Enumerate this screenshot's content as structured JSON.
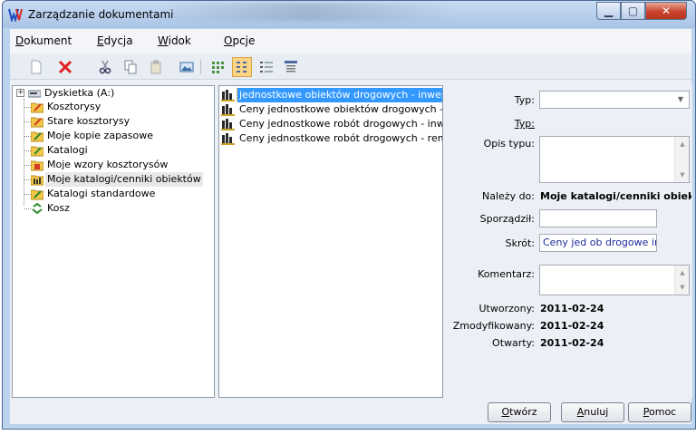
{
  "window": {
    "title": "Zarządzanie dokumentami",
    "minimize_glyph": "▁",
    "maximize_glyph": "▢",
    "close_glyph": "✕"
  },
  "menu": [
    {
      "label_first": "D",
      "label_rest": "okument"
    },
    {
      "label_first": "E",
      "label_rest": "dycja"
    },
    {
      "label_first": "W",
      "label_rest": "idok"
    },
    {
      "label_first": "O",
      "label_rest": "pcje"
    }
  ],
  "toolbar": {
    "icons": [
      "new-document-icon",
      "delete-icon",
      "cut-icon",
      "copy-icon",
      "paste-icon",
      "picture-icon",
      "large-icons-view-icon",
      "small-icons-view-icon",
      "list-view-icon",
      "details-view-icon"
    ],
    "active": "small-icons-view-icon"
  },
  "tree": {
    "items": [
      {
        "label": "Dyskietka (A:)",
        "icon": "floppy-drive-icon"
      },
      {
        "label": "Kosztorysy",
        "icon": "folder-pencil-icon"
      },
      {
        "label": "Stare kosztorysy",
        "icon": "folder-pencil-icon"
      },
      {
        "label": "Moje kopie zapasowe",
        "icon": "folder-pencil-icon"
      },
      {
        "label": "Katalogi",
        "icon": "folder-pencil-icon"
      },
      {
        "label": "Moje wzory kosztorysów",
        "icon": "template-folder-icon"
      },
      {
        "label": "Moje katalogi/cenniki obiektów",
        "icon": "objects-folder-icon"
      },
      {
        "label": "Katalogi standardowe",
        "icon": "folder-pencil-icon"
      },
      {
        "label": "Kosz",
        "icon": "recycle-bin-icon"
      }
    ],
    "selected_index": 6,
    "expander": "+"
  },
  "files": {
    "items": [
      "jednostkowe obiektów drogowych - inwestycyjne",
      "Ceny jednostkowe obiektów drogowych - remontowe",
      "Ceny jednostkowe robót drogowych - inwestycyjne",
      "Ceny jednostkowe robót drogowych - remontowe"
    ],
    "selected_index": 0
  },
  "props": {
    "typ_label": "Typ:",
    "typ_value": "",
    "typ2_label": "Typ:",
    "opis_label": "Opis typu:",
    "opis_value": "",
    "nalezy_label": "Należy do:",
    "nalezy_value": "Moje katalogi/cenniki obiektów",
    "sporzadzil_label": "Sporządził:",
    "sporzadzil_value": "",
    "skrot_label": "Skrót:",
    "skrot_value": "Ceny jed ob drogowe inw",
    "komentarz_label": "Komentarz:",
    "komentarz_value": "",
    "utworzony_label": "Utworzony:",
    "utworzony_value": "2011-02-24",
    "zmodyfikowany_label": "Zmodyfikowany:",
    "zmodyfikowany_value": "2011-02-24",
    "otwarty_label": "Otwarty:",
    "otwarty_value": "2011-02-24"
  },
  "buttons": {
    "open_first": "O",
    "open_rest": "twórz",
    "cancel_first": "A",
    "cancel_rest": "nuluj",
    "help_first": "P",
    "help_rest": "omoc"
  },
  "colors": {
    "selection": "#3399ff",
    "close_button": "#c9442c",
    "active_tool": "#fbd585"
  }
}
